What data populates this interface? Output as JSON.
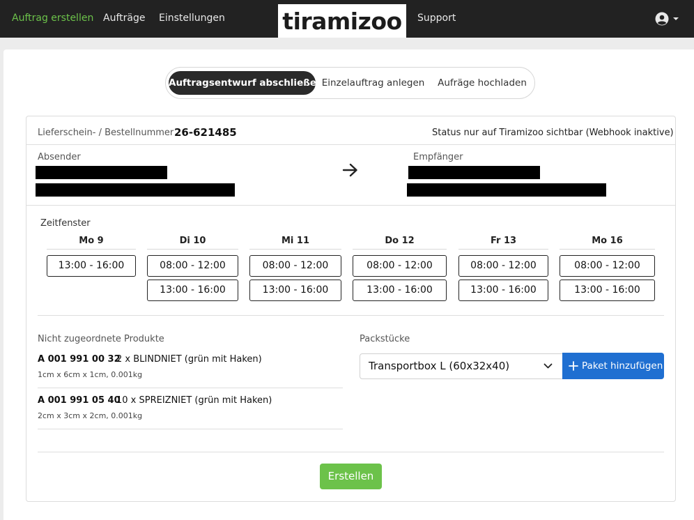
{
  "nav": {
    "items": [
      {
        "label": "Auftrag erstellen"
      },
      {
        "label": "Aufträge"
      },
      {
        "label": "Einstellungen"
      },
      {
        "label": "Support"
      }
    ],
    "brand": "tiramizoo",
    "active_color": "#6cc24a"
  },
  "tabs": [
    {
      "label": "Auftragsentwurf abschließen",
      "active": true
    },
    {
      "label": "Einzelauftrag anlegen",
      "active": false
    },
    {
      "label": "Aufräge hochladen",
      "active": false
    }
  ],
  "order": {
    "number_label": "Lieferschein- / Bestellnummer",
    "number": "26-621485",
    "status": "Status nur auf Tiramizoo sichtbar (Webhook inaktive)"
  },
  "sender": {
    "label": "Absender",
    "icon": "redacted"
  },
  "recipient": {
    "label": "Empfänger",
    "icon": "redacted"
  },
  "timewindow": {
    "label": "Zeitfenster",
    "days": [
      {
        "name": "Mo 9",
        "slots": [
          "13:00 - 16:00"
        ]
      },
      {
        "name": "Di 10",
        "slots": [
          "08:00 - 12:00",
          "13:00 - 16:00"
        ]
      },
      {
        "name": "Mi 11",
        "slots": [
          "08:00 - 12:00",
          "13:00 - 16:00"
        ]
      },
      {
        "name": "Do 12",
        "slots": [
          "08:00 - 12:00",
          "13:00 - 16:00"
        ]
      },
      {
        "name": "Fr 13",
        "slots": [
          "08:00 - 12:00",
          "13:00 - 16:00"
        ]
      },
      {
        "name": "Mo 16",
        "slots": [
          "08:00 - 12:00",
          "13:00 - 16:00"
        ]
      }
    ]
  },
  "products": {
    "label": "Nicht zugeordnete Produkte",
    "items": [
      {
        "code": "A 001 991 00 32",
        "desc": "2 x BLINDNIET (grün mit Haken)",
        "dims": "1cm x 6cm x 1cm, 0.001kg"
      },
      {
        "code": "A 001 991 05 40",
        "desc": "10 x SPREIZNIET (grün mit Haken)",
        "dims": "2cm x 3cm x 2cm, 0.001kg"
      }
    ]
  },
  "packages": {
    "label": "Packstücke",
    "selected": "Transportbox L (60x32x40)",
    "add_label": "Paket hinzufügen",
    "button_color": "#1f6fd1"
  },
  "create_label": "Erstellen",
  "create_color": "#6cc24a"
}
